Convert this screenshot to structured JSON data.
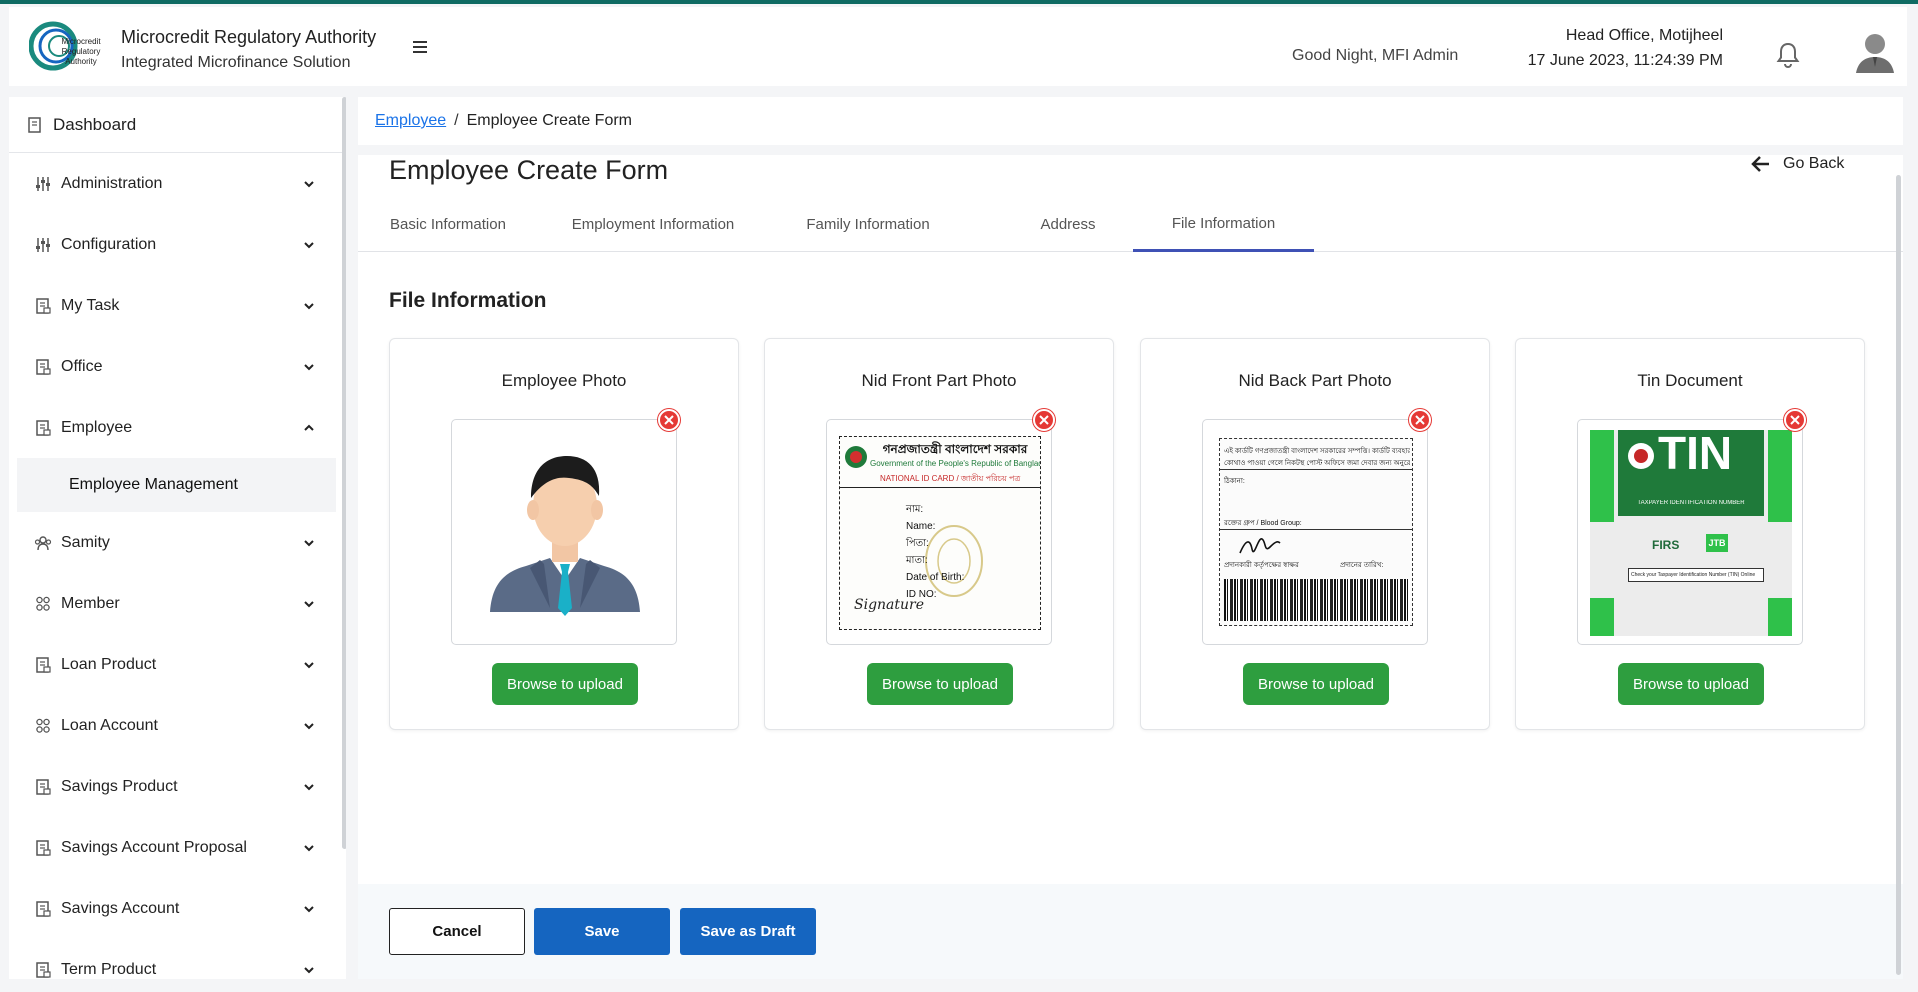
{
  "header": {
    "logo_text": [
      "Microcredit",
      "Regulatory",
      "Authority"
    ],
    "title": "Microcredit Regulatory Authority",
    "subtitle": "Integrated Microfinance Solution",
    "greeting": "Good Night, MFI Admin",
    "office": "Head Office, Motijheel",
    "datetime": "17 June 2023, 11:24:39 PM",
    "icons": {
      "menu": "hamburger-icon",
      "notifications": "bell-icon",
      "user": "user-avatar-icon"
    }
  },
  "sidebar": {
    "dashboard": "Dashboard",
    "items": [
      {
        "label": "Administration",
        "icon": "sliders-icon",
        "expanded": false
      },
      {
        "label": "Configuration",
        "icon": "sliders-icon",
        "expanded": false
      },
      {
        "label": "My Task",
        "icon": "document-icon",
        "expanded": false
      },
      {
        "label": "Office",
        "icon": "document-icon",
        "expanded": false
      },
      {
        "label": "Employee",
        "icon": "document-icon",
        "expanded": true
      }
    ],
    "sub_item": "Employee Management",
    "items_after": [
      {
        "label": "Samity",
        "icon": "group-icon",
        "expanded": false
      },
      {
        "label": "Member",
        "icon": "members-icon",
        "expanded": false
      },
      {
        "label": "Loan Product",
        "icon": "document-icon",
        "expanded": false
      },
      {
        "label": "Loan Account",
        "icon": "members-icon",
        "expanded": false
      },
      {
        "label": "Savings Product",
        "icon": "document-icon",
        "expanded": false
      },
      {
        "label": "Savings Account Proposal",
        "icon": "document-icon",
        "expanded": false
      },
      {
        "label": "Savings Account",
        "icon": "document-icon",
        "expanded": false
      },
      {
        "label": "Term Product",
        "icon": "document-icon",
        "expanded": false
      }
    ]
  },
  "breadcrumb": {
    "parent": "Employee",
    "current": "Employee Create Form"
  },
  "page": {
    "title": "Employee Create Form",
    "go_back": "Go Back",
    "tabs": [
      {
        "label": "Basic Information",
        "active": false
      },
      {
        "label": "Employment Information",
        "active": false
      },
      {
        "label": "Family Information",
        "active": false
      },
      {
        "label": "Address",
        "active": false
      },
      {
        "label": "File Information",
        "active": true
      }
    ],
    "section_title": "File Information",
    "files": [
      {
        "label": "Employee Photo",
        "button": "Browse to upload"
      },
      {
        "label": "Nid Front Part Photo",
        "button": "Browse to upload"
      },
      {
        "label": "Nid Back Part Photo",
        "button": "Browse to upload"
      },
      {
        "label": "Tin Document",
        "button": "Browse to upload"
      }
    ],
    "nid_front": {
      "title_bn": "গনপ্রজাতন্ত্রী বাংলাদেশ সরকার",
      "title_en": "Government of the People's Republic of Bangladesh",
      "card_label": "NATIONAL ID CARD / জাতীয় পরিচয় পত্র",
      "fields": [
        "নাম:",
        "Name:",
        "পিতা:",
        "মাতা:",
        "Date of Birth:",
        "ID NO:"
      ],
      "signature": "Signature"
    },
    "nid_back": {
      "line1": "এই কার্ডটি গণপ্রজাতন্ত্রী বাংলাদেশ সরকারের সম্পত্তি। কার্ডটি ব্যবহারকারী ব্যতীত অন্য",
      "line2": "কোথাও পাওয়া গেলে নিকটস্থ পোস্ট অফিসে জমা দেবার জন্য অনুরোধ করা হলো।",
      "address": "ঠিকানা:",
      "blood": "রক্তের গ্রুপ / Blood Group:",
      "sign_label": "প্রদানকারী কর্তৃপক্ষের স্বাক্ষর",
      "date_label": "প্রদানের তারিখ:"
    },
    "tin_doc": {
      "big": "TIN",
      "caption": "TAXPAYER IDENTIFICATION NUMBER",
      "logo1": "FIRS",
      "logo2": "JTB",
      "search": "Check your Taxpayer Identification Number (TIN) Online"
    },
    "buttons": {
      "cancel": "Cancel",
      "save": "Save",
      "draft": "Save as Draft"
    }
  },
  "colors": {
    "accent": "#3f51b5",
    "primary": "#1565c0",
    "upload": "#2e9e3f",
    "remove": "#e53935",
    "brand_teal": "#0f6b63"
  }
}
